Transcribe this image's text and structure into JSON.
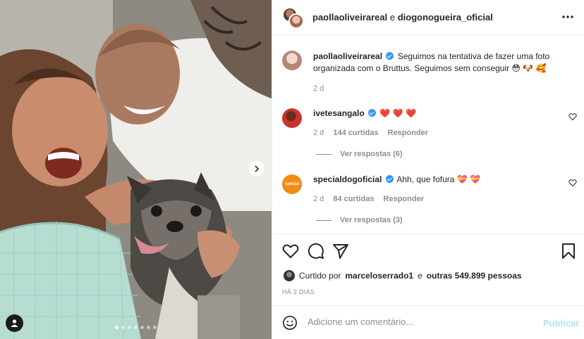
{
  "header": {
    "user1": "paollaoliveirareal",
    "connector": "e",
    "user2": "diogonogueira_oficial"
  },
  "caption": {
    "username": "paollaoliveirareal",
    "text": "Seguimos na tentativa de fazer uma foto organizada com o Bruttus. Seguimos sem conseguir 😳 🐶 🥰",
    "time": "2 d"
  },
  "comments": [
    {
      "username": "ivetesangalo",
      "text": "❤️ ❤️ ❤️",
      "time": "2 d",
      "likes": "144 curtidas",
      "reply": "Responder",
      "view_replies": "Ver respostas (6)"
    },
    {
      "username": "specialdogoficial",
      "avatar_text": "special",
      "text": "Ahh, que fofura 💝 💝",
      "time": "2 d",
      "likes": "84 curtidas",
      "reply": "Responder",
      "view_replies": "Ver respostas (3)"
    }
  ],
  "likes": {
    "prefix": "Curtido por",
    "user": "marceloserrado1",
    "connector": "e",
    "others": "outras 549.899 pessoas"
  },
  "post_date": "HÁ 2 DIAS",
  "comment_box": {
    "placeholder": "Adicione um comentário...",
    "publish_label": "Publicar"
  },
  "carousel": {
    "total": 7,
    "active_index": 0
  },
  "colors": {
    "verified": "#3897f0",
    "link_muted": "#8e8e8e",
    "publish_disabled": "#b2dffc",
    "heart_red": "#ed4956"
  }
}
